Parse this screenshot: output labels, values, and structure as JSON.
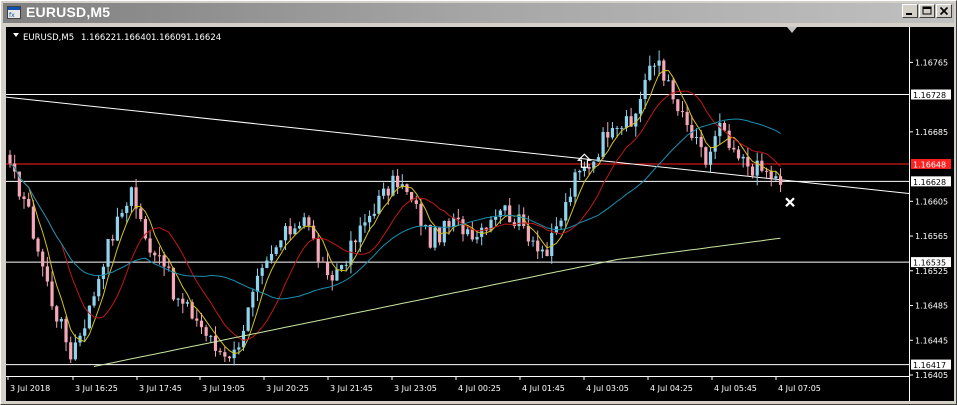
{
  "window": {
    "title": "EURUSD,M5",
    "controls": [
      "minimize",
      "maximize",
      "close"
    ]
  },
  "chart": {
    "header": {
      "symbol": "EURUSD,M5",
      "open": "1.16622",
      "high": "1.16640",
      "low": "1.16609",
      "close": "1.16624"
    },
    "bid_price": "1.16624",
    "alert_price": "1.16648",
    "colors": {
      "background": "#000000",
      "bull": "#8fd3ec",
      "bear": "#f4a8b8",
      "ma_fast": "#d6c21b",
      "ma_mid": "#c01818",
      "ma_slow": "#1a8fb0",
      "ma_long": "#c8e6a0",
      "alert_line": "#ff2020",
      "lines": "#ffffff"
    }
  },
  "chart_data": {
    "type": "candlestick",
    "y_ticks": [
      "1.16765",
      "1.16685",
      "1.16605",
      "1.16565",
      "1.16525",
      "1.16485",
      "1.16445",
      "1.16405"
    ],
    "y_range": [
      1.16405,
      1.16785
    ],
    "x_ticks": [
      "3 Jul 2018",
      "3 Jul 16:25",
      "3 Jul 17:45",
      "3 Jul 19:05",
      "3 Jul 20:25",
      "3 Jul 21:45",
      "3 Jul 23:05",
      "4 Jul 00:25",
      "4 Jul 01:45",
      "4 Jul 03:05",
      "4 Jul 04:25",
      "4 Jul 05:45",
      "4 Jul 07:05"
    ],
    "horizontal_lines": [
      {
        "price": 1.16728,
        "label": "1.16728",
        "color": "#ffffff"
      },
      {
        "price": 1.16648,
        "label": "1.16648",
        "color": "#ff2020"
      },
      {
        "price": 1.16628,
        "label": "1.16628",
        "color": "#ffffff"
      },
      {
        "price": 1.16535,
        "label": "1.16535",
        "color": "#ffffff"
      },
      {
        "price": 1.16417,
        "label": "1.16417",
        "color": "#ffffff"
      }
    ],
    "trendline": {
      "start_price": 1.16725,
      "end_price": 1.16614
    },
    "anchors": [
      {
        "bar": 0,
        "price": 1.1664
      },
      {
        "bar": 3,
        "price": 1.1661
      },
      {
        "bar": 9,
        "price": 1.1649
      },
      {
        "bar": 13,
        "price": 1.1643
      },
      {
        "bar": 17,
        "price": 1.1648
      },
      {
        "bar": 20,
        "price": 1.1654
      },
      {
        "bar": 26,
        "price": 1.1662
      },
      {
        "bar": 29,
        "price": 1.1656
      },
      {
        "bar": 33,
        "price": 1.1654
      },
      {
        "bar": 35,
        "price": 1.16495
      },
      {
        "bar": 40,
        "price": 1.1647
      },
      {
        "bar": 44,
        "price": 1.16435
      },
      {
        "bar": 48,
        "price": 1.1643
      },
      {
        "bar": 53,
        "price": 1.1651
      },
      {
        "bar": 58,
        "price": 1.1656
      },
      {
        "bar": 63,
        "price": 1.1659
      },
      {
        "bar": 68,
        "price": 1.1651
      },
      {
        "bar": 73,
        "price": 1.1655
      },
      {
        "bar": 78,
        "price": 1.166
      },
      {
        "bar": 83,
        "price": 1.1663
      },
      {
        "bar": 87,
        "price": 1.16595
      },
      {
        "bar": 90,
        "price": 1.1656
      },
      {
        "bar": 95,
        "price": 1.1658
      },
      {
        "bar": 100,
        "price": 1.1657
      },
      {
        "bar": 105,
        "price": 1.166
      },
      {
        "bar": 110,
        "price": 1.16575
      },
      {
        "bar": 115,
        "price": 1.16545
      },
      {
        "bar": 118,
        "price": 1.16585
      },
      {
        "bar": 121,
        "price": 1.1663
      },
      {
        "bar": 125,
        "price": 1.16655
      },
      {
        "bar": 129,
        "price": 1.167
      },
      {
        "bar": 133,
        "price": 1.1669
      },
      {
        "bar": 136,
        "price": 1.16745
      },
      {
        "bar": 139,
        "price": 1.1677
      },
      {
        "bar": 142,
        "price": 1.1672
      },
      {
        "bar": 146,
        "price": 1.1668
      },
      {
        "bar": 149,
        "price": 1.1665
      },
      {
        "bar": 152,
        "price": 1.1669
      },
      {
        "bar": 155,
        "price": 1.16655
      },
      {
        "bar": 159,
        "price": 1.16645
      },
      {
        "bar": 163,
        "price": 1.16635
      },
      {
        "bar": 165,
        "price": 1.16624
      }
    ],
    "total_bars": 166
  }
}
